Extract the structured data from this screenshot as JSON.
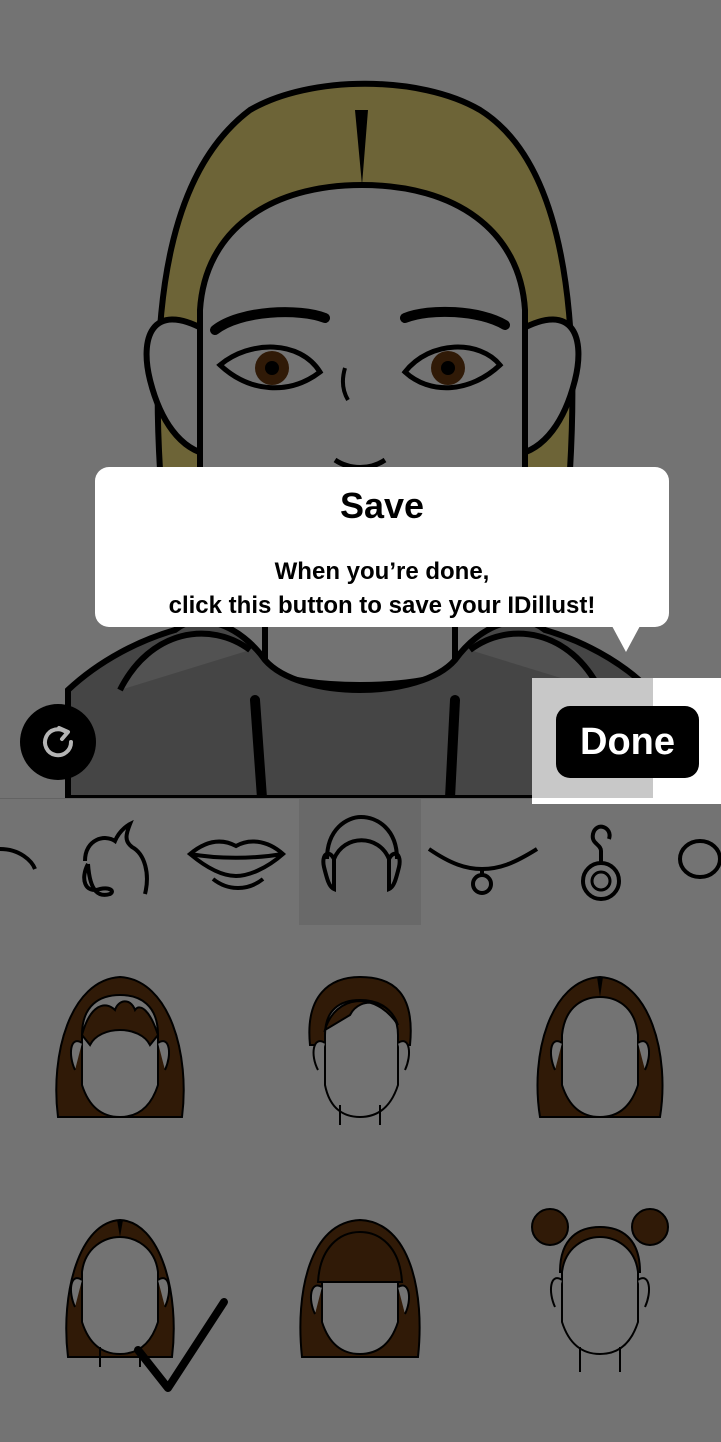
{
  "app": {
    "done_label": "Done",
    "reset_icon": "rotate-icon"
  },
  "tooltip": {
    "title": "Save",
    "line1": "When you’re done,",
    "line2": "click this button to save your IDillust!"
  },
  "categories": [
    {
      "name": "eyebrow-category",
      "icon": "eyebrow-icon"
    },
    {
      "name": "ear-category",
      "icon": "ear-icon"
    },
    {
      "name": "lips-category",
      "icon": "lips-icon"
    },
    {
      "name": "hair-category",
      "icon": "hair-icon",
      "selected": true
    },
    {
      "name": "necklace-category",
      "icon": "necklace-icon"
    },
    {
      "name": "earring-category",
      "icon": "earring-icon"
    },
    {
      "name": "ring-category",
      "icon": "ring-icon"
    }
  ],
  "hair_options": [
    {
      "style": "bob-bangs"
    },
    {
      "style": "short-side-part"
    },
    {
      "style": "medium-center-part"
    },
    {
      "style": "medium-straight",
      "selected": true
    },
    {
      "style": "blunt-bangs"
    },
    {
      "style": "space-buns"
    }
  ],
  "colors": {
    "hair_main": "#f2dd7a",
    "skin": "#ffffff",
    "hoodie": "#9a9a9a",
    "hair_option": "#6b3a10",
    "accent": "#000000"
  }
}
